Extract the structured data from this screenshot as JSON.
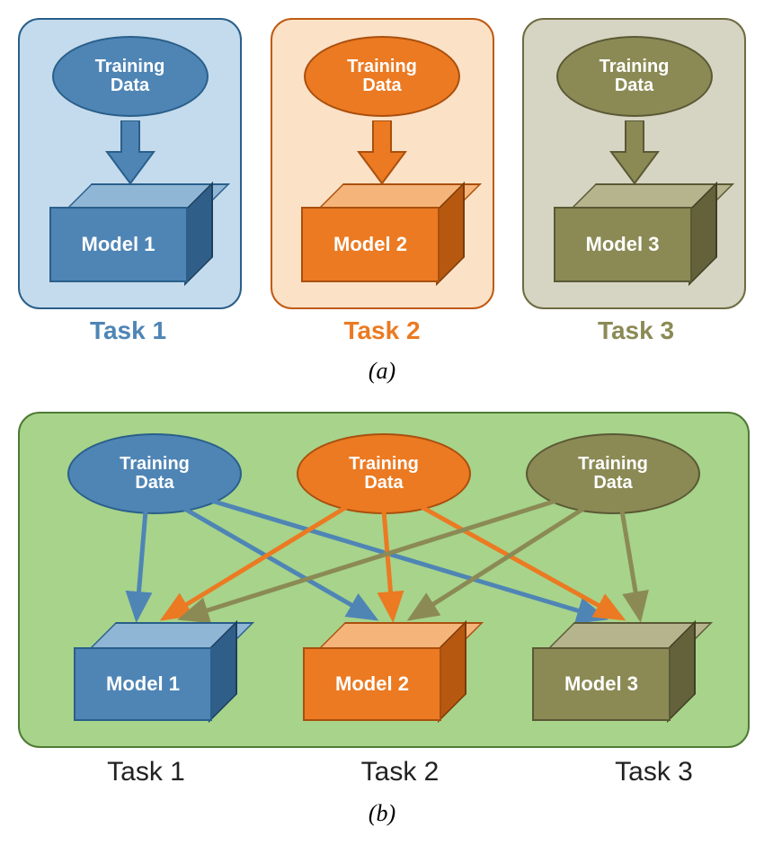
{
  "colors": {
    "blue": {
      "main": "#4f85b5",
      "light": "#90b6d6",
      "dark": "#2f5f89",
      "border": "#2a5f8a",
      "card": "#c4dbed"
    },
    "orange": {
      "main": "#eb7a22",
      "light": "#f5b57a",
      "dark": "#b75810",
      "border": "#aa4f0e",
      "card": "#fbe1c6"
    },
    "olive": {
      "main": "#8b8a55",
      "light": "#b5b48d",
      "dark": "#63623b",
      "border": "#5a5935",
      "card": "#d6d4c2"
    },
    "green_bg": "#a7d38b"
  },
  "panel_a": {
    "tasks": [
      {
        "color": "blue",
        "data_line1": "Training",
        "data_line2": "Data",
        "model_label": "Model 1",
        "task_label": "Task 1"
      },
      {
        "color": "orange",
        "data_line1": "Training",
        "data_line2": "Data",
        "model_label": "Model 2",
        "task_label": "Task 2"
      },
      {
        "color": "olive",
        "data_line1": "Training",
        "data_line2": "Data",
        "model_label": "Model 3",
        "task_label": "Task 3"
      }
    ],
    "caption": "(a)"
  },
  "panel_b": {
    "data_sources": [
      {
        "color": "blue",
        "line1": "Training",
        "line2": "Data"
      },
      {
        "color": "orange",
        "line1": "Training",
        "line2": "Data"
      },
      {
        "color": "olive",
        "line1": "Training",
        "line2": "Data"
      }
    ],
    "models": [
      {
        "color": "blue",
        "label": "Model 1"
      },
      {
        "color": "orange",
        "label": "Model 2"
      },
      {
        "color": "olive",
        "label": "Model 3"
      }
    ],
    "task_labels": [
      "Task 1",
      "Task 2",
      "Task 3"
    ],
    "caption": "(b)",
    "connections": "fully-connected (each data source -> every model)"
  }
}
